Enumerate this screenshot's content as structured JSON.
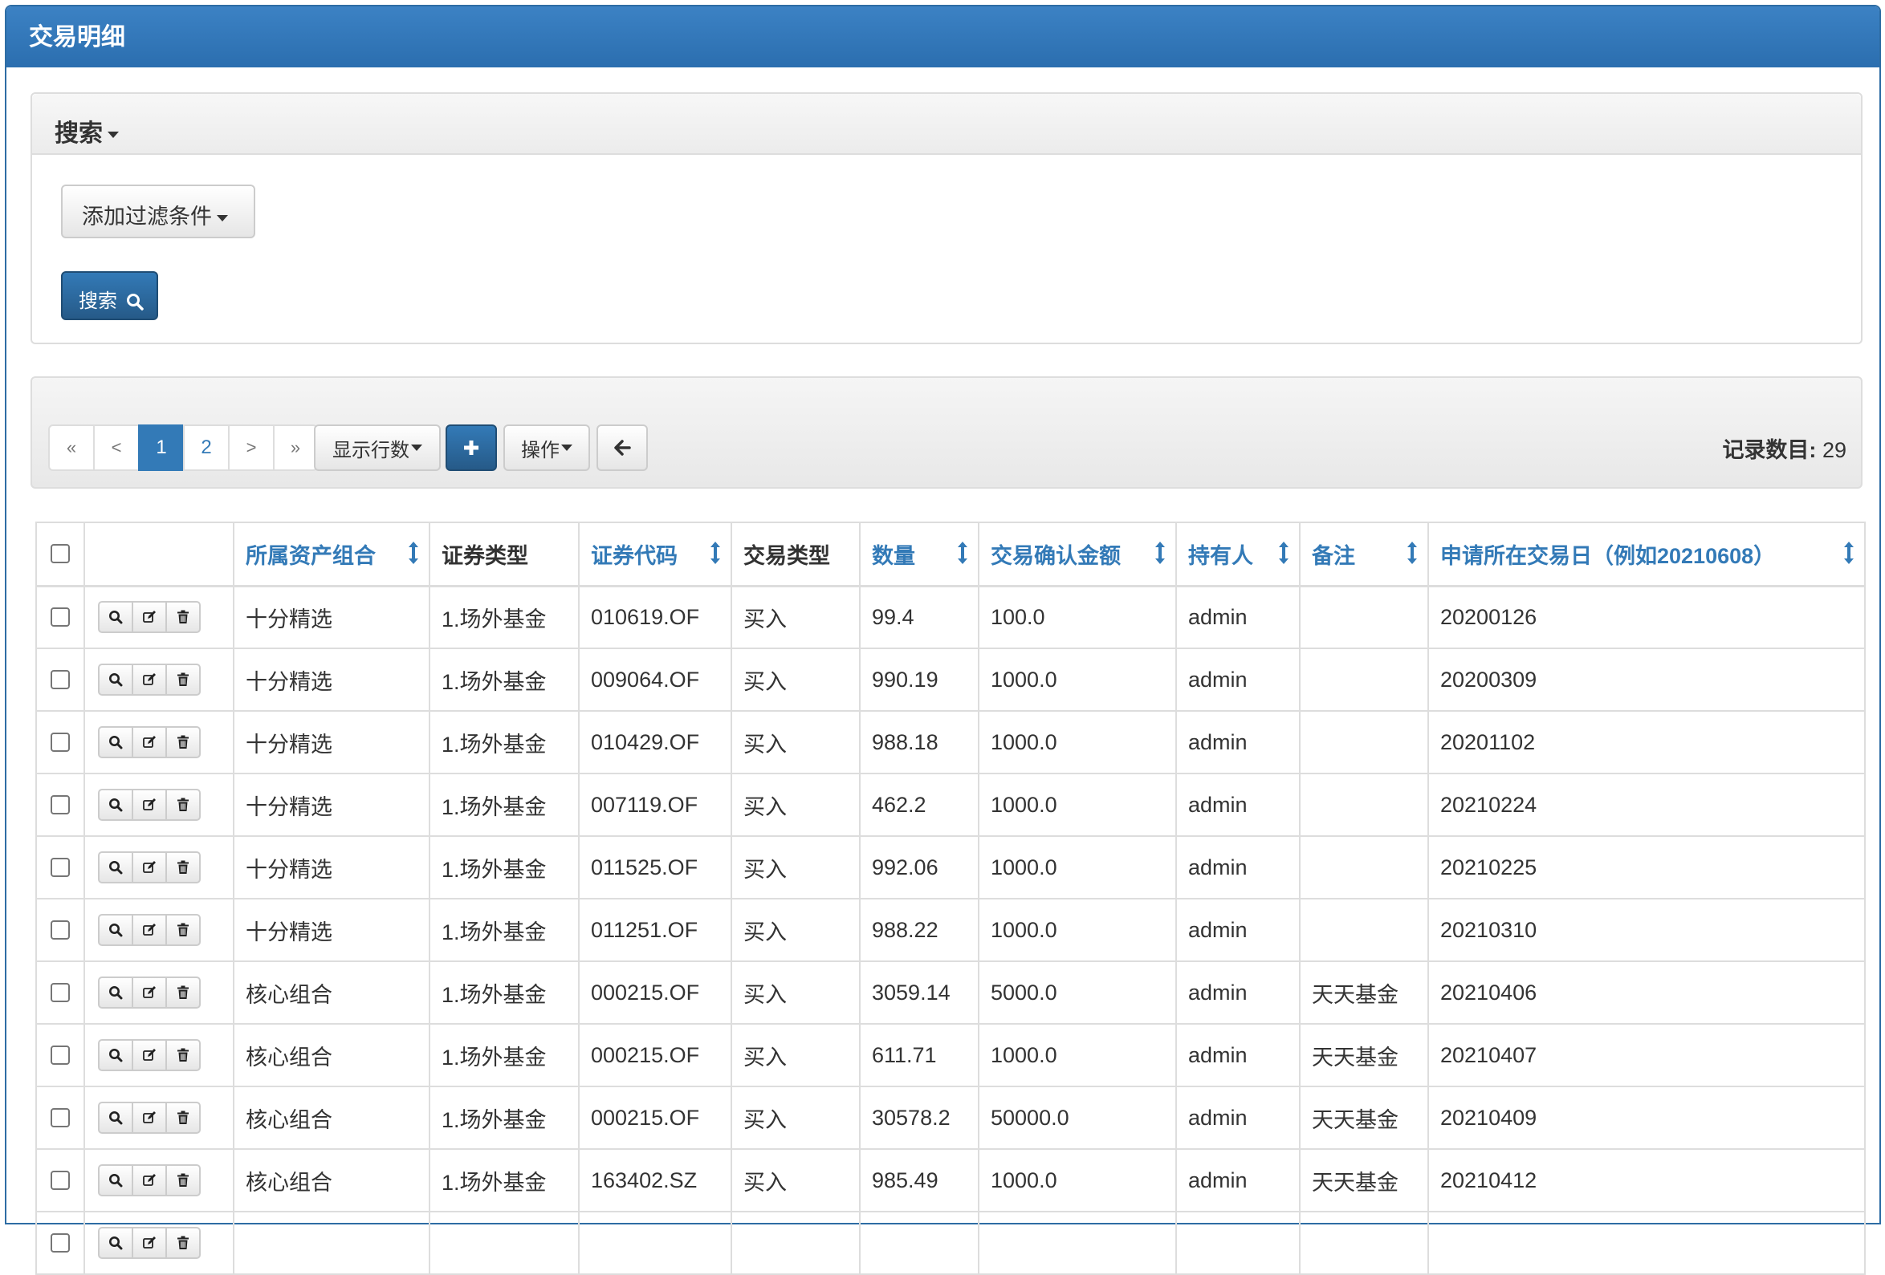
{
  "panel": {
    "title": "交易明细"
  },
  "search": {
    "header": "搜索",
    "add_filter_label": "添加过滤条件",
    "search_button_label": "搜索"
  },
  "toolbar": {
    "pager": {
      "first": "«",
      "prev": "<",
      "pages": [
        "1",
        "2"
      ],
      "current_page": "1",
      "next": ">",
      "last": "»"
    },
    "rows_per_page_label": "显示行数",
    "add_icon": "plus-icon",
    "actions_label": "操作",
    "back_icon": "arrow-left-icon",
    "record_count_label": "记录数目:",
    "record_count_value": "29"
  },
  "table": {
    "columns": [
      {
        "label": "所属资产组合",
        "sortable": true
      },
      {
        "label": "证券类型",
        "sortable": false
      },
      {
        "label": "证券代码",
        "sortable": true
      },
      {
        "label": "交易类型",
        "sortable": false
      },
      {
        "label": "数量",
        "sortable": true
      },
      {
        "label": "交易确认金额",
        "sortable": true
      },
      {
        "label": "持有人",
        "sortable": true
      },
      {
        "label": "备注",
        "sortable": true
      },
      {
        "label": "申请所在交易日（例如20210608）",
        "sortable": true
      }
    ],
    "row_action_icons": [
      "search-icon",
      "edit-icon",
      "trash-icon"
    ],
    "rows": [
      {
        "portfolio": "十分精选",
        "sec_type": "1.场外基金",
        "code": "010619.OF",
        "trade_type": "买入",
        "qty": "99.4",
        "amount": "100.0",
        "holder": "admin",
        "note": "",
        "date": "20200126"
      },
      {
        "portfolio": "十分精选",
        "sec_type": "1.场外基金",
        "code": "009064.OF",
        "trade_type": "买入",
        "qty": "990.19",
        "amount": "1000.0",
        "holder": "admin",
        "note": "",
        "date": "20200309"
      },
      {
        "portfolio": "十分精选",
        "sec_type": "1.场外基金",
        "code": "010429.OF",
        "trade_type": "买入",
        "qty": "988.18",
        "amount": "1000.0",
        "holder": "admin",
        "note": "",
        "date": "20201102"
      },
      {
        "portfolio": "十分精选",
        "sec_type": "1.场外基金",
        "code": "007119.OF",
        "trade_type": "买入",
        "qty": "462.2",
        "amount": "1000.0",
        "holder": "admin",
        "note": "",
        "date": "20210224"
      },
      {
        "portfolio": "十分精选",
        "sec_type": "1.场外基金",
        "code": "011525.OF",
        "trade_type": "买入",
        "qty": "992.06",
        "amount": "1000.0",
        "holder": "admin",
        "note": "",
        "date": "20210225"
      },
      {
        "portfolio": "十分精选",
        "sec_type": "1.场外基金",
        "code": "011251.OF",
        "trade_type": "买入",
        "qty": "988.22",
        "amount": "1000.0",
        "holder": "admin",
        "note": "",
        "date": "20210310"
      },
      {
        "portfolio": "核心组合",
        "sec_type": "1.场外基金",
        "code": "000215.OF",
        "trade_type": "买入",
        "qty": "3059.14",
        "amount": "5000.0",
        "holder": "admin",
        "note": "天天基金",
        "date": "20210406"
      },
      {
        "portfolio": "核心组合",
        "sec_type": "1.场外基金",
        "code": "000215.OF",
        "trade_type": "买入",
        "qty": "611.71",
        "amount": "1000.0",
        "holder": "admin",
        "note": "天天基金",
        "date": "20210407"
      },
      {
        "portfolio": "核心组合",
        "sec_type": "1.场外基金",
        "code": "000215.OF",
        "trade_type": "买入",
        "qty": "30578.2",
        "amount": "50000.0",
        "holder": "admin",
        "note": "天天基金",
        "date": "20210409"
      },
      {
        "portfolio": "核心组合",
        "sec_type": "1.场外基金",
        "code": "163402.SZ",
        "trade_type": "买入",
        "qty": "985.49",
        "amount": "1000.0",
        "holder": "admin",
        "note": "天天基金",
        "date": "20210412"
      },
      {
        "portfolio": "",
        "sec_type": "",
        "code": "",
        "trade_type": "",
        "qty": "",
        "amount": "",
        "holder": "",
        "note": "",
        "date": ""
      }
    ]
  }
}
